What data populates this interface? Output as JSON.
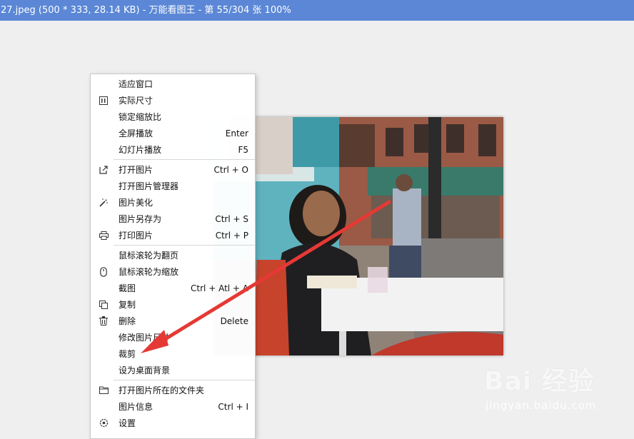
{
  "title_bar": {
    "text": "27.jpeg (500 * 333, 28.14 KB) - 万能看图王 - 第 55/304 张 100%"
  },
  "context_menu": {
    "groups": [
      [
        {
          "label": "适应窗口",
          "shortcut": "",
          "icon": ""
        },
        {
          "label": "实际尺寸",
          "shortcut": "",
          "icon": "actual-size-icon"
        },
        {
          "label": "锁定缩放比",
          "shortcut": "",
          "icon": ""
        },
        {
          "label": "全屏播放",
          "shortcut": "Enter",
          "icon": ""
        },
        {
          "label": "幻灯片播放",
          "shortcut": "F5",
          "icon": ""
        }
      ],
      [
        {
          "label": "打开图片",
          "shortcut": "Ctrl + O",
          "icon": "open-external-icon"
        },
        {
          "label": "打开图片管理器",
          "shortcut": "",
          "icon": ""
        },
        {
          "label": "图片美化",
          "shortcut": "",
          "icon": "magic-wand-icon"
        },
        {
          "label": "图片另存为",
          "shortcut": "Ctrl + S",
          "icon": ""
        },
        {
          "label": "打印图片",
          "shortcut": "Ctrl + P",
          "icon": "printer-icon"
        }
      ],
      [
        {
          "label": "鼠标滚轮为翻页",
          "shortcut": "",
          "icon": ""
        },
        {
          "label": "鼠标滚轮为缩放",
          "shortcut": "",
          "icon": "mouse-icon"
        },
        {
          "label": "截图",
          "shortcut": "Ctrl + Atl + A",
          "icon": ""
        },
        {
          "label": "复制",
          "shortcut": "",
          "icon": "copy-icon"
        },
        {
          "label": "删除",
          "shortcut": "Delete",
          "icon": "trash-icon"
        },
        {
          "label": "修改图片尺寸",
          "shortcut": "",
          "icon": ""
        },
        {
          "label": "裁剪",
          "shortcut": "",
          "icon": ""
        },
        {
          "label": "设为桌面背景",
          "shortcut": "",
          "icon": ""
        }
      ],
      [
        {
          "label": "打开图片所在的文件夹",
          "shortcut": "",
          "icon": "folder-icon"
        },
        {
          "label": "图片信息",
          "shortcut": "Ctrl + I",
          "icon": ""
        },
        {
          "label": "设置",
          "shortcut": "",
          "icon": "gear-icon"
        }
      ]
    ]
  },
  "annotation": {
    "arrow_color": "#e53935"
  },
  "watermark": {
    "logo": "Bai 经验",
    "sub": "jingyan.baidu.com"
  }
}
